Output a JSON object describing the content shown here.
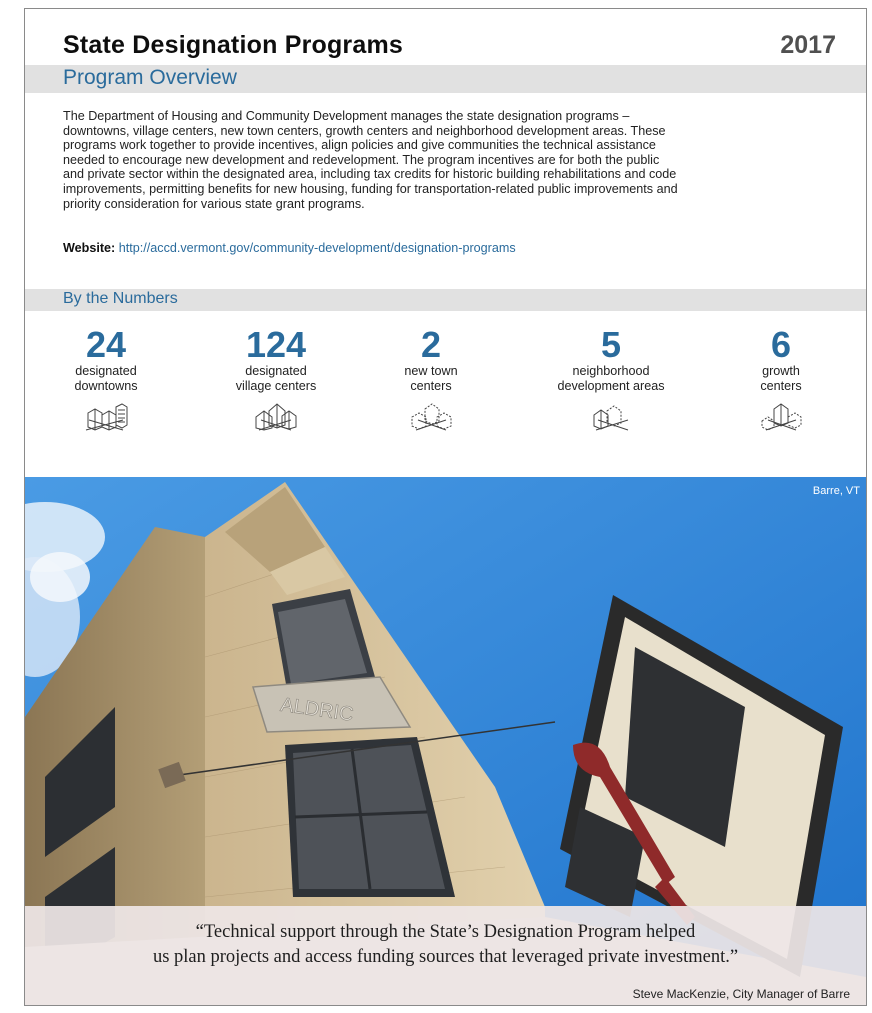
{
  "header": {
    "title": "State Designation Programs",
    "year": "2017"
  },
  "overview": {
    "heading": "Program Overview",
    "lines": [
      "The Department of Housing and Community Development manages the state designation programs –",
      "downtowns, village centers, new town centers, growth centers and neighborhood development areas. These",
      "programs work together to provide incentives, align policies and give communities the technical assistance",
      "needed to encourage new development and redevelopment. The program incentives are for both the public",
      "and private sector within the designated area, including tax credits for historic building rehabilitations and code",
      "improvements, permitting benefits for new housing, funding for transportation-related public improvements and",
      "priority consideration for various state grant programs."
    ],
    "website_label": "Website:",
    "website_url": "http://accd.vermont.gov/community-development/designation-programs"
  },
  "numbers": {
    "heading": "By the Numbers",
    "items": [
      {
        "value": "24",
        "line1": "designated",
        "line2": "downtowns",
        "icon": "downtown-buildings-icon"
      },
      {
        "value": "124",
        "line1": "designated",
        "line2": "village centers",
        "icon": "village-houses-icon"
      },
      {
        "value": "2",
        "line1": "new town",
        "line2": "centers",
        "icon": "new-town-icon"
      },
      {
        "value": "5",
        "line1": "neighborhood",
        "line2": "development areas",
        "icon": "neighborhood-icon"
      },
      {
        "value": "6",
        "line1": "growth",
        "line2": "centers",
        "icon": "growth-center-icon"
      }
    ]
  },
  "photo": {
    "location": "Barre, VT",
    "sign_text": "ALDRIC",
    "quote_line1": "“Technical support through the State’s Designation Program helped",
    "quote_line2": "us plan projects and access funding sources that leveraged private investment.”",
    "attribution": "Steve MacKenzie, City Manager of Barre"
  },
  "colors": {
    "accent_blue": "#2a6b9c",
    "band_gray": "#e1e1e1",
    "sky": "#2f86d8"
  }
}
